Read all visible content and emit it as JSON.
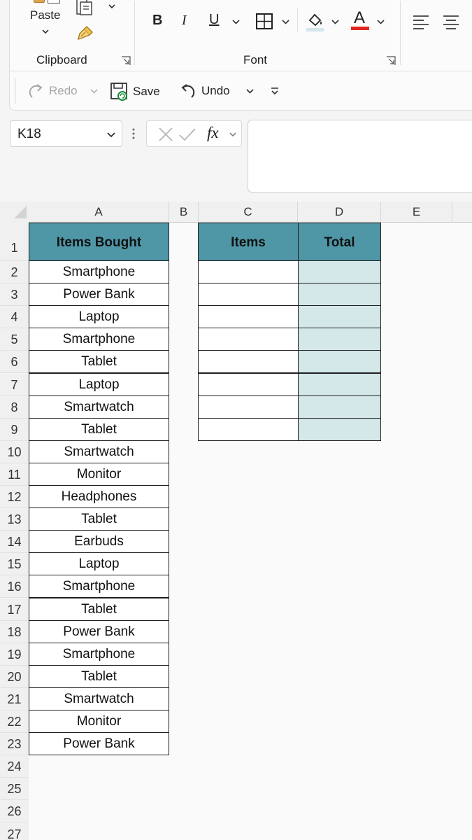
{
  "ribbon": {
    "paste_label": "Paste",
    "clipboard_label": "Clipboard",
    "font_label": "Font",
    "bold_label": "B",
    "italic_label": "I",
    "underline_label": "U",
    "font_color_letter": "A",
    "font_color": "#e0261d",
    "fill_color": "#d6e6ee"
  },
  "qat": {
    "redo_label": "Redo",
    "save_label": "Save",
    "undo_label": "Undo"
  },
  "formula_bar": {
    "name_box": "K18",
    "fx_label": "fx",
    "formula": ""
  },
  "sheet": {
    "columns": [
      "A",
      "B",
      "C",
      "D",
      "E"
    ],
    "rows": [
      "1",
      "2",
      "3",
      "4",
      "5",
      "6",
      "7",
      "8",
      "9",
      "10",
      "11",
      "12",
      "13",
      "14",
      "15",
      "16",
      "17",
      "18",
      "19",
      "20",
      "21",
      "22",
      "23",
      "24",
      "25",
      "26",
      "27"
    ],
    "items_bought_header": "Items Bought",
    "items_bought": [
      "Smartphone",
      "Power Bank",
      "Laptop",
      "Smartphone",
      "Tablet",
      "Laptop",
      "Smartwatch",
      "Tablet",
      "Smartwatch",
      "Monitor",
      "Headphones",
      "Tablet",
      "Earbuds",
      "Laptop",
      "Smartphone",
      "Tablet",
      "Power Bank",
      "Smartphone",
      "Tablet",
      "Smartwatch",
      "Monitor",
      "Power Bank"
    ],
    "summary_headers": {
      "items": "Items",
      "total": "Total"
    },
    "header_color": "#4f97a6",
    "total_fill_color": "#d4e7e9"
  }
}
